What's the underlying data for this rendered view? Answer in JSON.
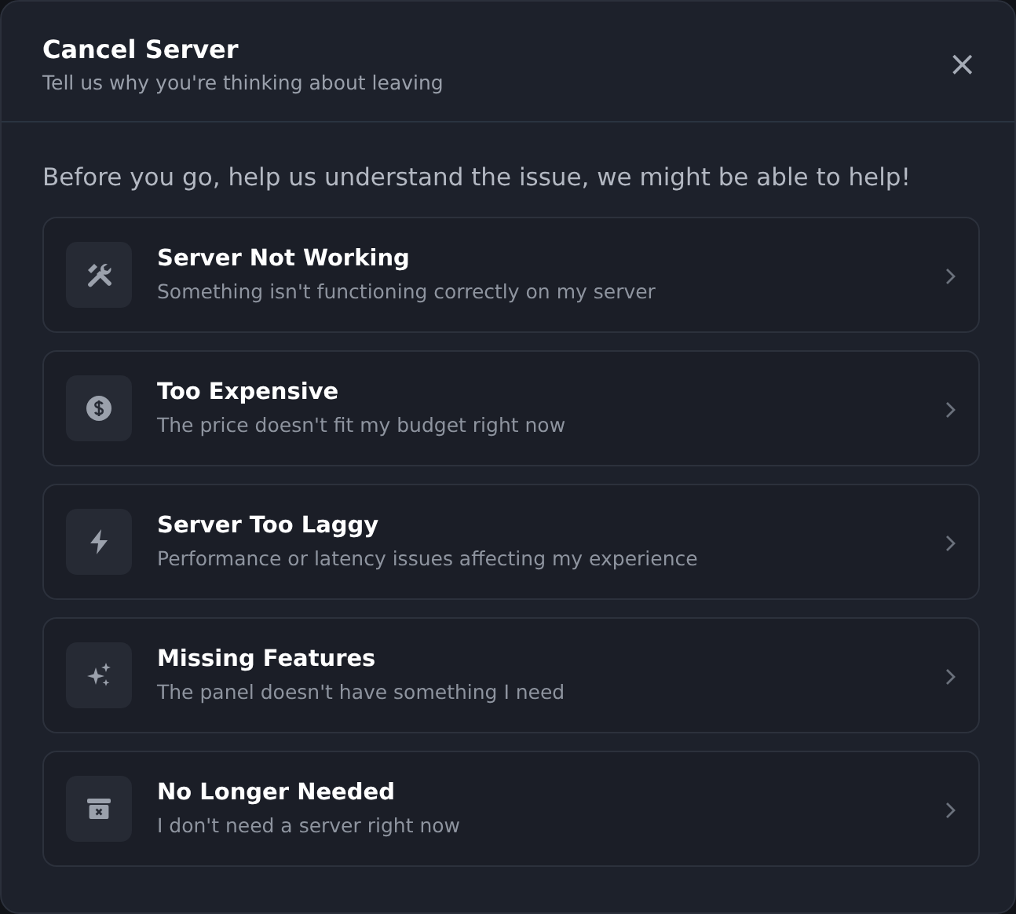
{
  "dialog": {
    "title": "Cancel Server",
    "subtitle": "Tell us why you're thinking about leaving",
    "close": "×"
  },
  "intro": "Before you go, help us understand the issue, we might be able to help!",
  "reasons": [
    {
      "kind": "tools",
      "title": "Server Not Working",
      "description": "Something isn't functioning correctly on my server"
    },
    {
      "kind": "dollar",
      "title": "Too Expensive",
      "description": "The price doesn't fit my budget right now"
    },
    {
      "kind": "bolt",
      "title": "Server Too Laggy",
      "description": "Performance or latency issues affecting my experience"
    },
    {
      "kind": "sparkles",
      "title": "Missing Features",
      "description": "The panel doesn't have something I need"
    },
    {
      "kind": "archive",
      "title": "No Longer Needed",
      "description": "I don't need a server right now"
    }
  ]
}
